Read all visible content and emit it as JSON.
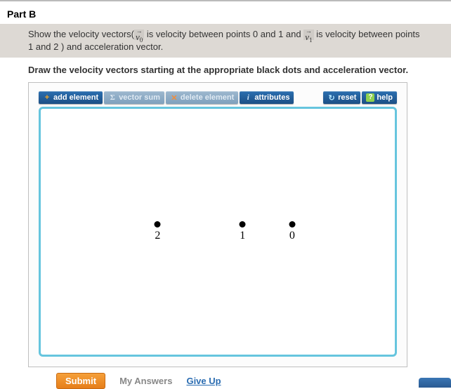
{
  "part_label": "Part B",
  "prompt": {
    "lead": "Show the velocity vectors(",
    "vec0_base": "v",
    "vec0_sub": "0",
    "mid1": " is velocity between points 0 and 1 and ",
    "vec1_base": "v",
    "vec1_sub": "1",
    "mid2": " is velocity between points",
    "line2": "1 and 2 ) and acceleration vector."
  },
  "instruction": "Draw the velocity vectors starting at the appropriate black dots and acceleration vector.",
  "toolbar": {
    "add": "add element",
    "sum": "vector sum",
    "del": "delete element",
    "attr": "attributes",
    "reset": "reset",
    "help": "help"
  },
  "points": [
    {
      "label": "2",
      "x": 33,
      "y": 50
    },
    {
      "label": "1",
      "x": 57,
      "y": 50
    },
    {
      "label": "0",
      "x": 71,
      "y": 50
    }
  ],
  "buttons": {
    "submit": "Submit",
    "my_answers": "My Answers",
    "give_up": "Give Up"
  }
}
